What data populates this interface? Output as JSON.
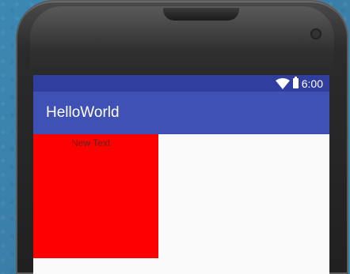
{
  "status_bar": {
    "time": "6:00",
    "icons": [
      "wifi-icon",
      "battery-icon"
    ],
    "color": "#303f9f"
  },
  "app_bar": {
    "title": "HelloWorld",
    "color": "#3f51b5"
  },
  "content": {
    "text_view": "New Text",
    "red_view_color": "#ff0000"
  }
}
